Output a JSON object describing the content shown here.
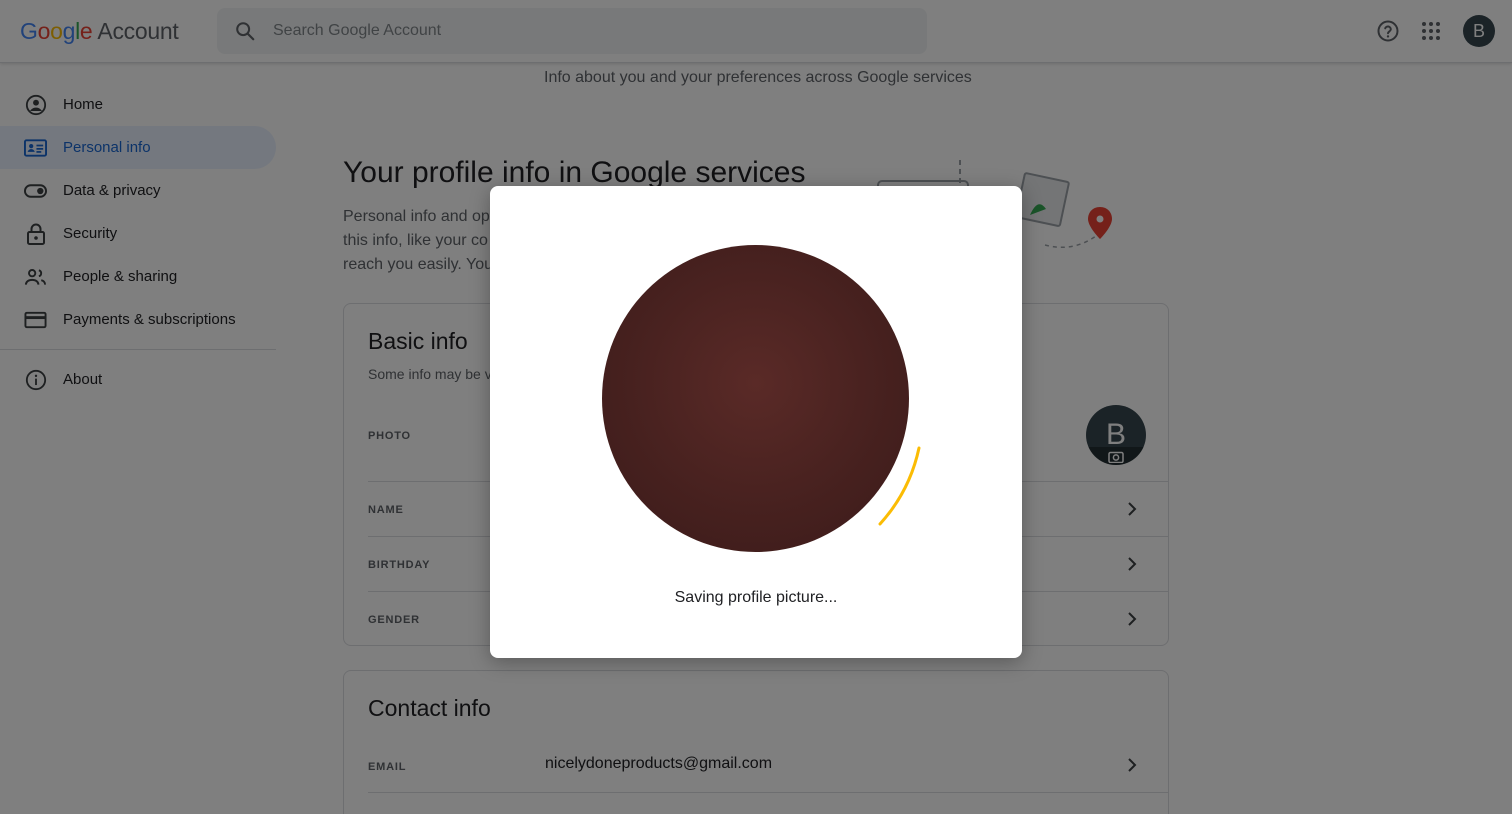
{
  "header": {
    "logo_google": [
      "G",
      "o",
      "o",
      "g",
      "l",
      "e"
    ],
    "logo_account": "Account",
    "search_placeholder": "Search Google Account",
    "avatar_letter": "B",
    "icons": [
      "search-icon",
      "help-icon",
      "apps-grid-icon"
    ]
  },
  "sidebar": {
    "items": [
      {
        "label": "Home",
        "icon": "account-circle-icon"
      },
      {
        "label": "Personal info",
        "icon": "id-card-icon",
        "active": true
      },
      {
        "label": "Data & privacy",
        "icon": "toggle-icon"
      },
      {
        "label": "Security",
        "icon": "lock-icon"
      },
      {
        "label": "People & sharing",
        "icon": "people-icon"
      },
      {
        "label": "Payments & subscriptions",
        "icon": "credit-card-icon"
      }
    ],
    "about": {
      "label": "About",
      "icon": "info-icon"
    }
  },
  "main": {
    "subheading": "Info about you and your preferences across Google services",
    "title": "Your profile info in Google services",
    "intro_lines": [
      "Personal info and op",
      "this info, like your co",
      "reach you easily. You"
    ],
    "basic_info": {
      "title": "Basic info",
      "subtitle": "Some info may be v",
      "rows": [
        {
          "label": "PHOTO"
        },
        {
          "label": "NAME"
        },
        {
          "label": "BIRTHDAY"
        },
        {
          "label": "GENDER"
        }
      ],
      "photo_letter": "B"
    },
    "contact_info": {
      "title": "Contact info",
      "rows": [
        {
          "label": "EMAIL",
          "value": "nicelydoneproducts@gmail.com"
        }
      ]
    }
  },
  "dialog": {
    "status_text": "Saving profile picture...",
    "spinner_color": "#fbbc04"
  },
  "colors": {
    "accent_blue": "#1967d2",
    "active_bg": "#e8f0fe",
    "avatar_bg": "#37474f"
  }
}
